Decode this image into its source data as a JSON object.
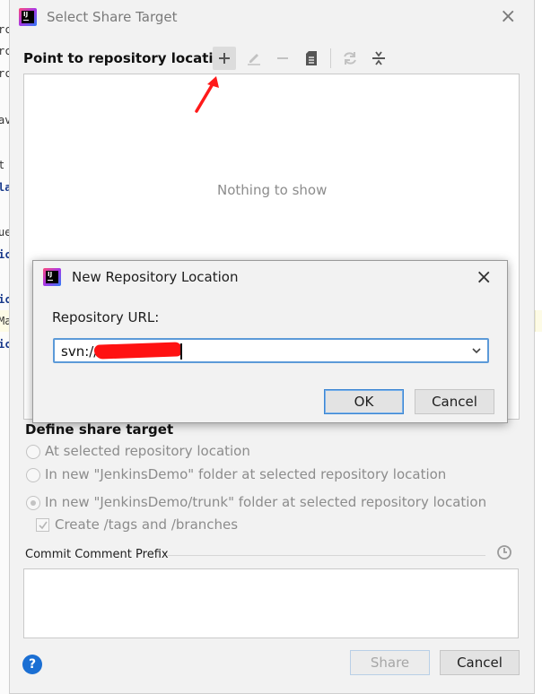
{
  "main_dialog": {
    "title": "Select Share Target",
    "app_icon_text": "IJ",
    "section_label": "Point to repository location",
    "toolbar": [
      {
        "name": "add-icon",
        "active": true
      },
      {
        "name": "edit-icon",
        "active": false
      },
      {
        "name": "remove-icon",
        "active": false
      },
      {
        "name": "browse-icon",
        "active": false
      },
      {
        "name": "refresh-icon",
        "active": false
      },
      {
        "name": "collapse-icon",
        "active": false
      }
    ],
    "tree_empty_text": "Nothing to show",
    "define_label": "Define share target",
    "options": [
      {
        "label": "At selected repository location",
        "checked": false
      },
      {
        "label": "In new \"JenkinsDemo\" folder at selected repository location",
        "checked": false
      },
      {
        "label": "In new \"JenkinsDemo/trunk\" folder at selected repository location",
        "checked": true
      }
    ],
    "create_tags_label": "Create /tags and /branches",
    "create_tags_checked": true,
    "commit_prefix_label": "Commit Comment Prefix",
    "commit_prefix_value": "",
    "share_button": "Share",
    "cancel_button": "Cancel",
    "help_glyph": "?"
  },
  "sub_dialog": {
    "title": "New Repository Location",
    "url_label": "Repository URL:",
    "url_value": "svn://",
    "ok_button": "OK",
    "cancel_button": "Cancel"
  },
  "editor_fragments": [
    "rc",
    "rc",
    "rc",
    "av",
    "t",
    "la",
    "ue",
    "ic",
    "ic",
    "Ma",
    "ic"
  ],
  "colors": {
    "accent": "#3c86d3",
    "help": "#1b6fd3",
    "annotation_arrow": "#ff1a1a",
    "redaction": "#ff1212"
  }
}
